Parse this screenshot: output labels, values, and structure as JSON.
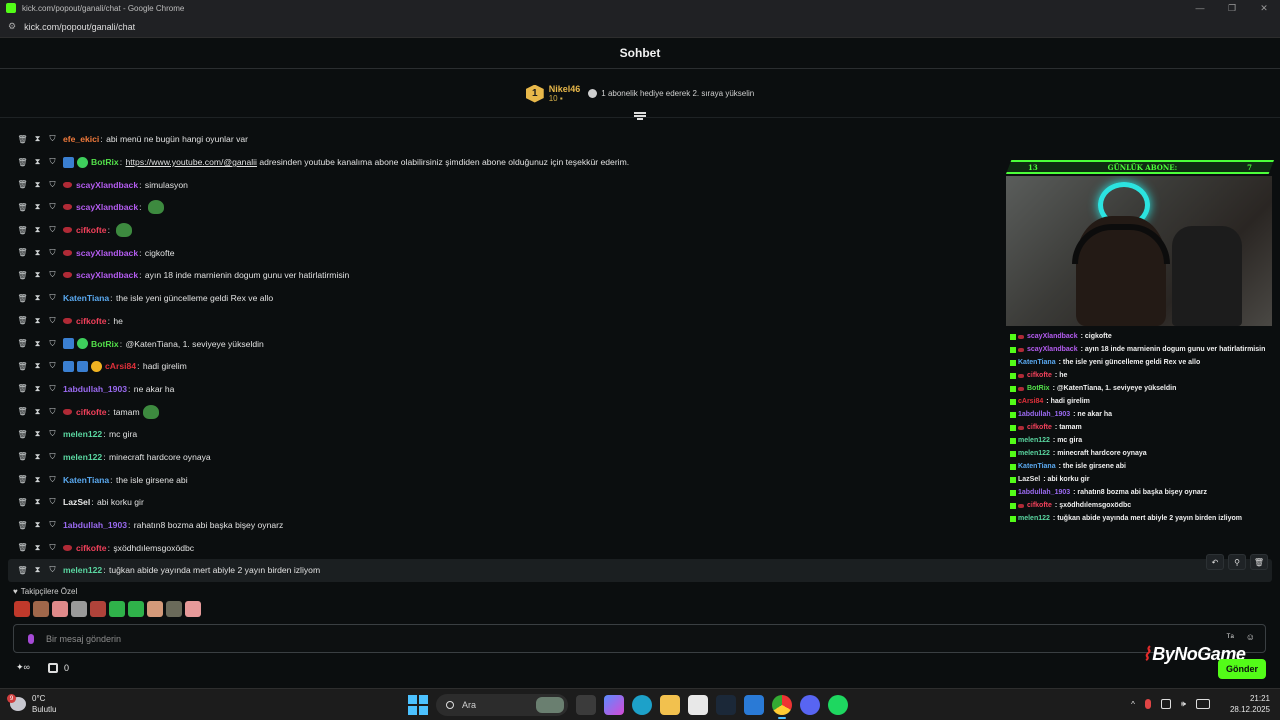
{
  "browser": {
    "title": "kick.com/popout/ganali/chat - Google Chrome",
    "url": "kick.com/popout/ganali/chat"
  },
  "chat": {
    "title": "Sohbet"
  },
  "leaderboard": {
    "rank": "1",
    "username": "Nikel46",
    "count": "10",
    "hint": "1 abonelik hediye ederek 2. sıraya yükselin"
  },
  "messages": [
    {
      "user": "efe_ekici",
      "color": "#f07a3c",
      "text": "abi menü ne bugün hangi oyunlar var",
      "badges": []
    },
    {
      "user": "BotRix",
      "color": "#53e04a",
      "link": "https://www.youtube.com/@ganalii",
      "text": " adresinden youtube kanalıma abone olabilirsiniz şimdiden abone olduğunuz için teşekkür ederim.",
      "badges": [
        "blue",
        "green"
      ]
    },
    {
      "user": "scayXlandback",
      "color": "#b45cf0",
      "text": "simulasyon",
      "badges": [
        "red"
      ]
    },
    {
      "user": "scayXlandback",
      "color": "#b45cf0",
      "text": "",
      "emote": true,
      "badges": [
        "red"
      ]
    },
    {
      "user": "cifkofte",
      "color": "#f0405a",
      "text": "",
      "emote": true,
      "badges": [
        "red"
      ]
    },
    {
      "user": "scayXlandback",
      "color": "#b45cf0",
      "text": "cigkofte",
      "badges": [
        "red"
      ]
    },
    {
      "user": "scayXlandback",
      "color": "#b45cf0",
      "text": "ayın 18 inde marnienin dogum gunu ver hatirlatirmisin",
      "badges": [
        "red"
      ]
    },
    {
      "user": "KatenTiana",
      "color": "#5aa9f0",
      "text": "the isle yeni güncelleme geldi Rex ve allo",
      "badges": []
    },
    {
      "user": "cifkofte",
      "color": "#f0405a",
      "text": "he",
      "badges": [
        "red"
      ]
    },
    {
      "user": "BotRix",
      "color": "#53e04a",
      "text": "@KatenTiana, 1. seviyeye yükseldin",
      "badges": [
        "blue",
        "green"
      ]
    },
    {
      "user": "cArsi84",
      "color": "#e0303a",
      "text": "hadi girelim",
      "badges": [
        "blue",
        "blue",
        "gold"
      ]
    },
    {
      "user": "1abdullah_1903",
      "color": "#9a6af0",
      "text": "ne akar ha",
      "badges": []
    },
    {
      "user": "cifkofte",
      "color": "#f0405a",
      "text": "tamam",
      "emote": true,
      "badges": [
        "red"
      ]
    },
    {
      "user": "melen122",
      "color": "#5ad6a0",
      "text": "mc gira",
      "badges": []
    },
    {
      "user": "melen122",
      "color": "#5ad6a0",
      "text": "minecraft hardcore oynaya",
      "badges": []
    },
    {
      "user": "KatenTiana",
      "color": "#5aa9f0",
      "text": "the isle girsene abi",
      "badges": []
    },
    {
      "user": "LazSel",
      "color": "#e8e8e8",
      "text": "abi korku gir",
      "badges": []
    },
    {
      "user": "1abdullah_1903",
      "color": "#9a6af0",
      "text": "rahatın8 bozma abi başka bişey oynarz",
      "badges": []
    },
    {
      "user": "cifkofte",
      "color": "#f0405a",
      "text": "şxödhdılemsgoxödbc",
      "badges": [
        "red"
      ]
    },
    {
      "user": "melen122",
      "color": "#5ad6a0",
      "text": "tuğkan abide yayında mert abiyle 2 yayın birden izliyom",
      "badges": []
    }
  ],
  "overlay": {
    "banner_left": "13",
    "banner_title": "GÜNLÜK ABONE:",
    "banner_right": "7",
    "lines": [
      {
        "user": "scayXlandback",
        "color": "#b45cf0",
        "text": "cigkofte",
        "badge": "red"
      },
      {
        "user": "scayXlandback",
        "color": "#b45cf0",
        "text": "ayın 18 inde marnienin dogum gunu ver hatirlatirmisin",
        "badge": "red"
      },
      {
        "user": "KatenTiana",
        "color": "#5aa9f0",
        "text": "the isle yeni güncelleme geldi Rex ve allo",
        "badge": ""
      },
      {
        "user": "cifkofte",
        "color": "#f0405a",
        "text": "he",
        "badge": "red"
      },
      {
        "user": "BotRix",
        "color": "#53e04a",
        "text": "@KatenTiana, 1. seviyeye yükseldin",
        "badge": "red"
      },
      {
        "user": "cArsi84",
        "color": "#e0303a",
        "text": "hadi girelim",
        "badge": ""
      },
      {
        "user": "1abdullah_1903",
        "color": "#9a6af0",
        "text": "ne akar ha",
        "badge": ""
      },
      {
        "user": "cifkofte",
        "color": "#f0405a",
        "text": "tamam",
        "badge": "red"
      },
      {
        "user": "melen122",
        "color": "#5ad6a0",
        "text": "mc gira",
        "badge": ""
      },
      {
        "user": "melen122",
        "color": "#5ad6a0",
        "text": "minecraft hardcore oynaya",
        "badge": ""
      },
      {
        "user": "KatenTiana",
        "color": "#5aa9f0",
        "text": "the isle girsene abi",
        "badge": ""
      },
      {
        "user": "LazSel",
        "color": "#e8e8e8",
        "text": "abi korku gir",
        "badge": ""
      },
      {
        "user": "1abdullah_1903",
        "color": "#9a6af0",
        "text": "rahatın8 bozma abi başka bişey oynarz",
        "badge": ""
      },
      {
        "user": "cifkofte",
        "color": "#f0405a",
        "text": "şxödhdılemsgoxödbc",
        "badge": "red"
      },
      {
        "user": "melen122",
        "color": "#5ad6a0",
        "text": "tuğkan abide yayında mert abiyle 2 yayın birden izliyom",
        "badge": ""
      }
    ]
  },
  "emote_bar": {
    "label": "Takipçilere Özel",
    "emotes": [
      "#c0392b",
      "#a0674a",
      "#e08a8a",
      "#9a9a9a",
      "#b0433a",
      "#2fb24a",
      "#2fb24a",
      "#d49a7a",
      "#6a6a5a",
      "#e79a9a"
    ]
  },
  "input": {
    "placeholder": "Bir mesaj gönderin"
  },
  "bottom": {
    "infinity": "∞",
    "gift_count": "0",
    "send_label": "Gönder",
    "watermark": "ByNoGame"
  },
  "taskbar": {
    "weather_temp": "0°C",
    "weather_desc": "Bulutlu",
    "weather_badge": "9",
    "search_placeholder": "Ara",
    "time": "21:21",
    "date": "28.12.2025"
  },
  "colors": {
    "accent": "#53fc18",
    "background": "#0b0e0f"
  }
}
